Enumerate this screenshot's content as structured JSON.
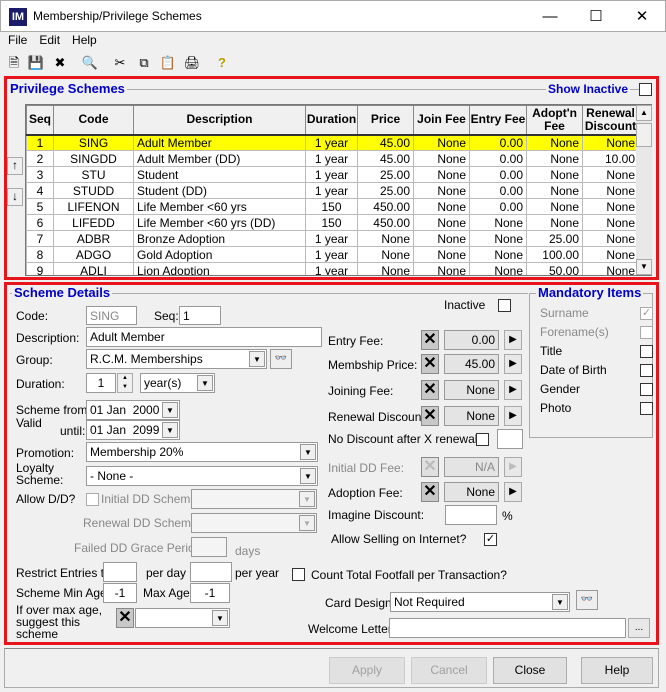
{
  "window": {
    "title": "Membership/Privilege Schemes",
    "icon": "IM"
  },
  "menu": [
    "File",
    "Edit",
    "Help"
  ],
  "toolbar": [
    "new-icon",
    "save-icon",
    "delete-icon",
    "find-icon",
    "cut-icon",
    "copy-icon",
    "paste-icon",
    "print-icon",
    "help-icon"
  ],
  "schemes": {
    "title": "Privilege Schemes",
    "show_inactive": "Show Inactive",
    "show_inactive_checked": false,
    "columns": [
      "Seq",
      "Code",
      "Description",
      "Duration",
      "Price",
      "Join Fee",
      "Entry Fee",
      "Adopt'n Fee",
      "Renewal Discount"
    ],
    "rows": [
      [
        "1",
        "SING",
        "Adult Member",
        "1 year",
        "45.00",
        "None",
        "0.00",
        "None",
        "None"
      ],
      [
        "2",
        "SINGDD",
        "Adult Member (DD)",
        "1 year",
        "45.00",
        "None",
        "0.00",
        "None",
        "10.00"
      ],
      [
        "3",
        "STU",
        "Student",
        "1 year",
        "25.00",
        "None",
        "0.00",
        "None",
        "None"
      ],
      [
        "4",
        "STUDD",
        "Student (DD)",
        "1 year",
        "25.00",
        "None",
        "0.00",
        "None",
        "None"
      ],
      [
        "5",
        "LIFENON",
        "Life Member <60 yrs",
        "150",
        "450.00",
        "None",
        "0.00",
        "None",
        "None"
      ],
      [
        "6",
        "LIFEDD",
        "Life Member <60 yrs (DD)",
        "150",
        "450.00",
        "None",
        "None",
        "None",
        "None"
      ],
      [
        "7",
        "ADBR",
        "Bronze Adoption",
        "1 year",
        "None",
        "None",
        "None",
        "25.00",
        "None"
      ],
      [
        "8",
        "ADGO",
        "Gold Adoption",
        "1 year",
        "None",
        "None",
        "None",
        "100.00",
        "None"
      ],
      [
        "9",
        "ADLI",
        "Lion Adoption",
        "1 year",
        "None",
        "None",
        "None",
        "50.00",
        "None"
      ]
    ],
    "selected_row": 0,
    "highlight": "#ffff00"
  },
  "details": {
    "title": "Scheme Details",
    "code_label": "Code:",
    "code": "SING",
    "seq_label": "Seq:",
    "seq": "1",
    "inactive_label": "Inactive",
    "description_label": "Description:",
    "description": "Adult Member",
    "group_label": "Group:",
    "group": "R.C.M. Memberships",
    "duration_label": "Duration:",
    "duration": "1",
    "duration_unit": "year(s)",
    "scheme_from_label": "Scheme from:",
    "valid_label": "Valid",
    "until_label": "until:",
    "from": "01 Jan  2000",
    "until": "01 Jan  2099",
    "promotion_label": "Promotion:",
    "promotion": "Membership 20%",
    "loyalty_label": "Loyalty Scheme:",
    "loyalty": "- None -",
    "allow_dd_label": "Allow D/D?",
    "initial_dd_label": "Initial DD Scheme:",
    "renewal_dd_label": "Renewal DD Scheme:",
    "grace_label": "Failed DD Grace Period:",
    "days": "days",
    "restrict_label": "Restrict Entries to:",
    "per_day": "per day",
    "per_year": "per year",
    "min_age_label": "Scheme Min Age",
    "min_age": "-1",
    "max_age_label": "Max Age",
    "max_age": "-1",
    "over_age_label": "If over max age, suggest this scheme",
    "entry_fee_label": "Entry Fee:",
    "entry_fee": "0.00",
    "price_label": "Membship Price:",
    "price": "45.00",
    "joining_label": "Joining Fee:",
    "joining": "None",
    "renewal_label": "Renewal Discount:",
    "renewal": "None",
    "no_discount_label": "No Discount after X renewals:",
    "initial_dd_fee_label": "Initial DD Fee:",
    "initial_dd_fee": "N/A",
    "adoption_label": "Adoption Fee:",
    "adoption": "None",
    "imagine_label": "Imagine Discount:",
    "percent": "%",
    "internet_label": "Allow Selling on Internet?",
    "internet_checked": true,
    "footfall_label": "Count Total Footfall per Transaction?",
    "card_label": "Card Design:",
    "card": "Not Required",
    "welcome_label": "Welcome Letter:",
    "browse": "..."
  },
  "mandatory": {
    "title": "Mandatory Items",
    "items": [
      {
        "label": "Surname",
        "checked": true,
        "disabled": true
      },
      {
        "label": "Forename(s)",
        "checked": false,
        "disabled": true
      },
      {
        "label": "Title",
        "checked": false
      },
      {
        "label": "Date of Birth",
        "checked": false
      },
      {
        "label": "Gender",
        "checked": false
      },
      {
        "label": "Photo",
        "checked": false
      }
    ]
  },
  "buttons": {
    "apply": "Apply",
    "cancel": "Cancel",
    "close": "Close",
    "help": "Help"
  }
}
